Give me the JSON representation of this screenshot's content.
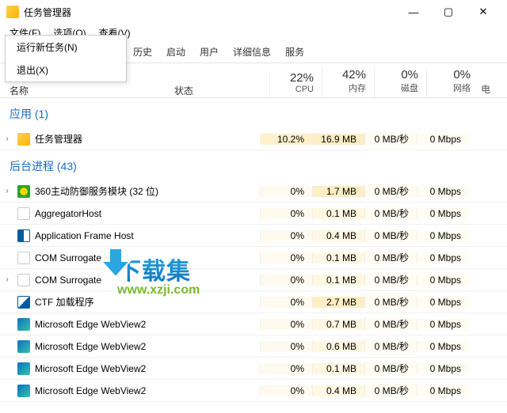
{
  "window": {
    "title": "任务管理器"
  },
  "menubar": {
    "file": "文件(F)",
    "options": "选项(O)",
    "view": "查看(V)"
  },
  "file_menu": {
    "run": "运行新任务(N)",
    "exit": "退出(X)"
  },
  "tabs": {
    "history": "历史",
    "startup": "启动",
    "users": "用户",
    "details": "详细信息",
    "services": "服务"
  },
  "columns": {
    "name": "名称",
    "status": "状态",
    "cpu_pct": "22%",
    "cpu_lbl": "CPU",
    "mem_pct": "42%",
    "mem_lbl": "内存",
    "disk_pct": "0%",
    "disk_lbl": "磁盘",
    "net_pct": "0%",
    "net_lbl": "网络",
    "extra": "电"
  },
  "groups": {
    "apps": "应用 (1)",
    "bg": "后台进程 (43)"
  },
  "rows": [
    {
      "exp": "›",
      "icon": "ico-tm",
      "name": "任务管理器",
      "cpu": "10.2%",
      "mem": "16.9 MB",
      "disk": "0 MB/秒",
      "net": "0 Mbps",
      "hi": true
    },
    {
      "exp": "›",
      "icon": "ico-360",
      "name": "360主动防御服务模块 (32 位)",
      "cpu": "0%",
      "mem": "1.7 MB",
      "disk": "0 MB/秒",
      "net": "0 Mbps"
    },
    {
      "exp": "",
      "icon": "ico-blank",
      "name": "AggregatorHost",
      "cpu": "0%",
      "mem": "0.1 MB",
      "disk": "0 MB/秒",
      "net": "0 Mbps"
    },
    {
      "exp": "",
      "icon": "ico-afh",
      "name": "Application Frame Host",
      "cpu": "0%",
      "mem": "0.4 MB",
      "disk": "0 MB/秒",
      "net": "0 Mbps"
    },
    {
      "exp": "",
      "icon": "ico-blank",
      "name": "COM Surrogate",
      "cpu": "0%",
      "mem": "0.1 MB",
      "disk": "0 MB/秒",
      "net": "0 Mbps"
    },
    {
      "exp": "›",
      "icon": "ico-blank",
      "name": "COM Surrogate",
      "cpu": "0%",
      "mem": "0.1 MB",
      "disk": "0 MB/秒",
      "net": "0 Mbps"
    },
    {
      "exp": "",
      "icon": "ico-ctf",
      "name": "CTF 加载程序",
      "cpu": "0%",
      "mem": "2.7 MB",
      "disk": "0 MB/秒",
      "net": "0 Mbps"
    },
    {
      "exp": "",
      "icon": "ico-edge",
      "name": "Microsoft Edge WebView2",
      "cpu": "0%",
      "mem": "0.7 MB",
      "disk": "0 MB/秒",
      "net": "0 Mbps"
    },
    {
      "exp": "",
      "icon": "ico-edge",
      "name": "Microsoft Edge WebView2",
      "cpu": "0%",
      "mem": "0.6 MB",
      "disk": "0 MB/秒",
      "net": "0 Mbps"
    },
    {
      "exp": "",
      "icon": "ico-edge",
      "name": "Microsoft Edge WebView2",
      "cpu": "0%",
      "mem": "0.1 MB",
      "disk": "0 MB/秒",
      "net": "0 Mbps"
    },
    {
      "exp": "",
      "icon": "ico-edge",
      "name": "Microsoft Edge WebView2",
      "cpu": "0%",
      "mem": "0.4 MB",
      "disk": "0 MB/秒",
      "net": "0 Mbps"
    }
  ],
  "watermark": {
    "cn": "下载集",
    "url": "www.xzji.com"
  }
}
